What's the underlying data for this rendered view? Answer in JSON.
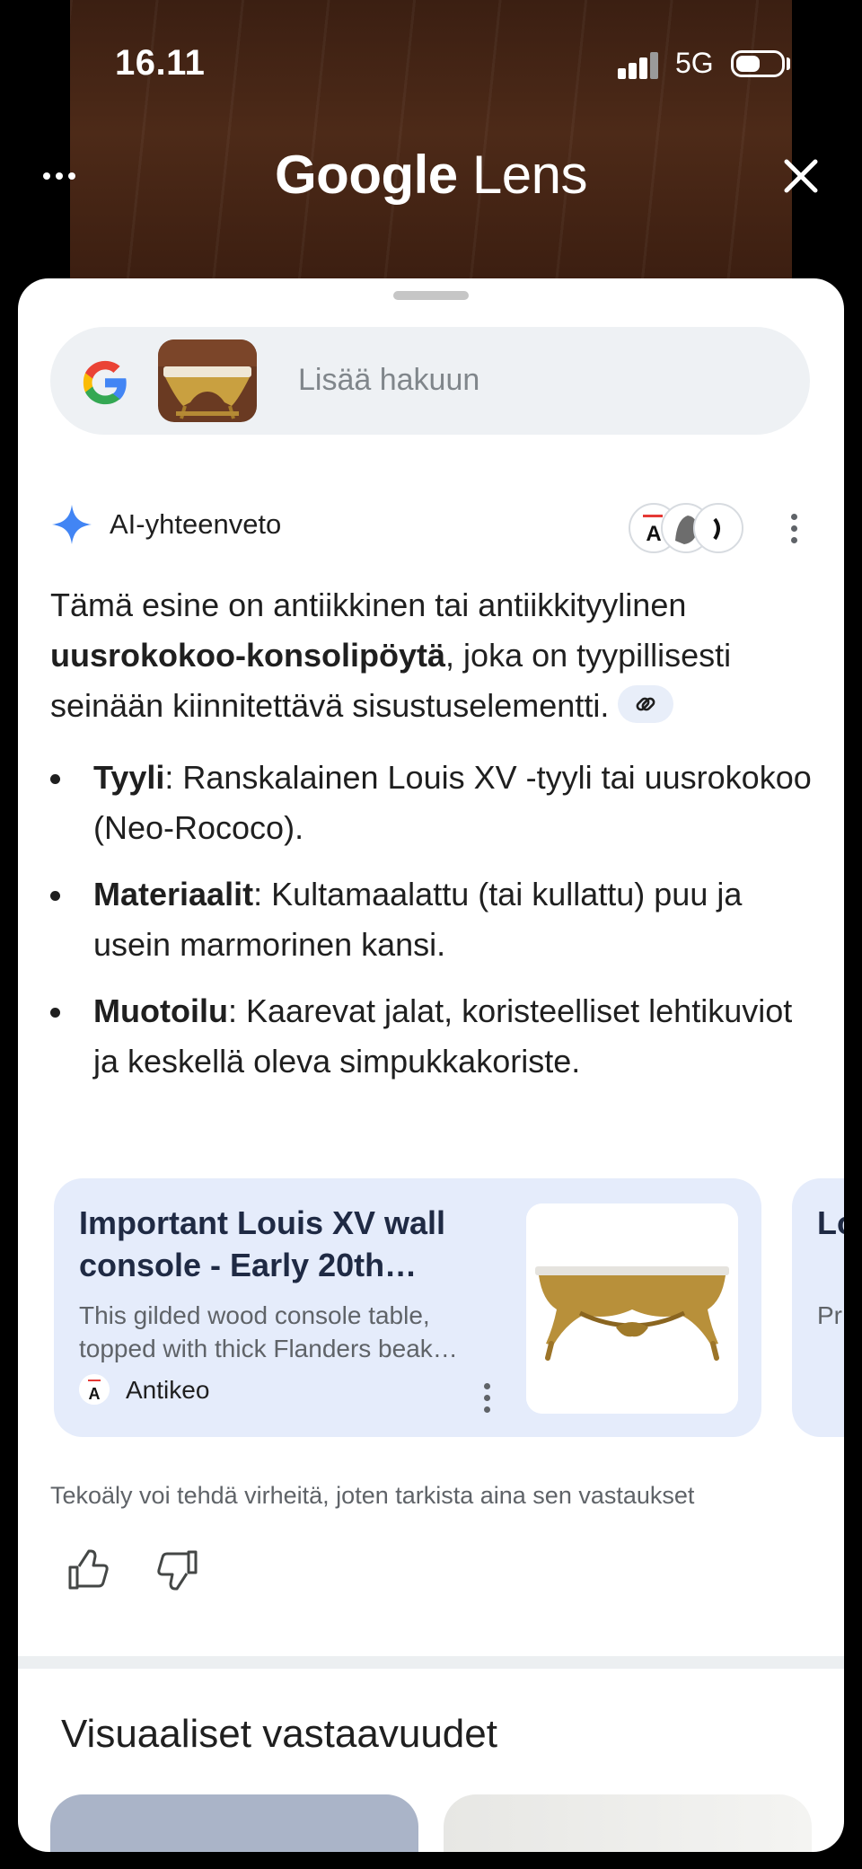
{
  "status_bar": {
    "time": "16.11",
    "network": "5G"
  },
  "header": {
    "title_bold": "Google",
    "title_rest": " Lens"
  },
  "search": {
    "placeholder": "Lisää hakuun"
  },
  "ai_overview": {
    "label": "AI-yhteenveto",
    "intro_pre": "Tämä esine on antiikkinen tai antiikkityylinen ",
    "intro_bold": "uusrokokoo-konsolipöytä",
    "intro_post": ", joka on tyypillisesti seinään kiinnitettävä sisustuselementti.",
    "bullets": [
      {
        "term": "Tyyli",
        "text": ": Ranskalainen Louis XV -tyyli tai uusrokokoo (Neo-Rococo)."
      },
      {
        "term": "Materiaalit",
        "text": ": Kultamaalattu (tai kullattu) puu ja usein marmorinen kansi."
      },
      {
        "term": "Muotoilu",
        "text": ": Kaarevat jalat, koristeelliset lehtikuviot ja keskellä oleva simpukkakoriste."
      }
    ]
  },
  "source_cards": [
    {
      "title": "Important Louis XV wall console - Early 20th…",
      "description": "This gilded wood console table, topped with thick Flanders beak…",
      "source": "Antikeo"
    },
    {
      "title": "Lo W",
      "description": "Pr Wa"
    }
  ],
  "disclaimer": "Tekoäly voi tehdä virheitä, joten tarkista aina sen vastaukset",
  "visual_matches": {
    "heading": "Visuaaliset vastaavuudet"
  },
  "colors": {
    "accent": "#4285f4",
    "card_bg": "#e5ecfb",
    "pill_bg": "#eef1f4"
  }
}
